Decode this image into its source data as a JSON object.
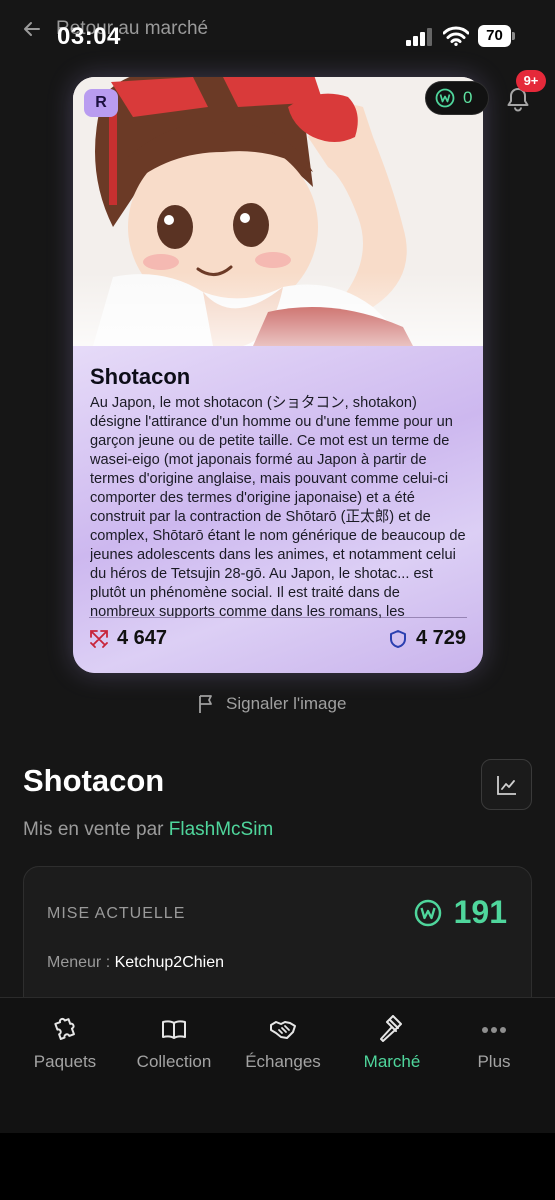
{
  "status_bar": {
    "time": "03:04",
    "battery": "70"
  },
  "header": {
    "back_label": "Retour au marché",
    "notification_badge": "9+"
  },
  "card": {
    "rarity": "R",
    "coins": "0",
    "title": "Shotacon",
    "description": "Au Japon, le mot shotacon (ショタコン, shotakon) désigne l'attirance d'un homme ou d'une femme pour un garçon jeune ou de petite taille. Ce mot est un terme de wasei-eigo (mot japonais formé au Japon à partir de termes d'origine anglaise, mais pouvant comme celui-ci comporter des termes d'origine japonaise) et a été construit par la contraction de Shōtarō (正太郎) et de complex, Shōtarō étant le nom générique de beaucoup de jeunes adolescents dans les animes, et notamment celui du héros de Tetsujin 28-gō. Au Japon, le shotac... est plutôt un phénomène social. Il est traité dans de nombreux supports comme dans les romans, les",
    "attack": "4 647",
    "defense": "4 729"
  },
  "report_label": "Signaler l'image",
  "listing": {
    "title": "Shotacon",
    "seller_prefix": "Mis en vente par ",
    "seller_name": "FlashMcSim"
  },
  "bid": {
    "label": "MISE ACTUELLE",
    "amount": "191",
    "leader_prefix": "Meneur : ",
    "leader_name": "Ketchup2Chien"
  },
  "nav": {
    "items": [
      {
        "label": "Paquets",
        "icon": "puzzle-icon"
      },
      {
        "label": "Collection",
        "icon": "book-icon"
      },
      {
        "label": "Échanges",
        "icon": "handshake-icon"
      },
      {
        "label": "Marché",
        "icon": "gavel-icon",
        "active": true
      },
      {
        "label": "Plus",
        "icon": "more-dots-icon"
      }
    ]
  },
  "colors": {
    "accent": "#4fd69c",
    "badge": "#e5293a",
    "rarity": "#b99cf0",
    "card_body": "#d7c6f3"
  }
}
